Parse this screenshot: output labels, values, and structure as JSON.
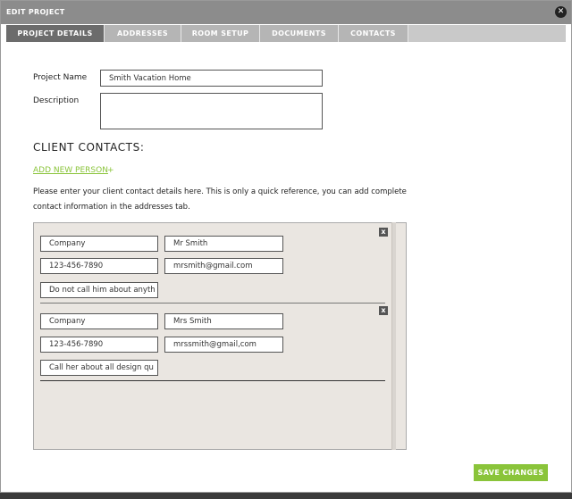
{
  "window": {
    "title": "EDIT PROJECT",
    "close_icon": "close-icon"
  },
  "tabs": [
    {
      "label": "PROJECT DETAILS",
      "active": true
    },
    {
      "label": "ADDRESSES",
      "active": false
    },
    {
      "label": "ROOM SETUP",
      "active": false
    },
    {
      "label": "DOCUMENTS",
      "active": false
    },
    {
      "label": "CONTACTS",
      "active": false
    }
  ],
  "form": {
    "project_name_label": "Project Name",
    "project_name_value": "Smith Vacation Home",
    "description_label": "Description",
    "description_value": ""
  },
  "client_contacts": {
    "heading": "CLIENT CONTACTS:",
    "add_link": "ADD NEW PERSON",
    "add_plus": "+",
    "help_text": "Please enter your client contact details here. This is only a quick reference, you can add complete contact information in the addresses tab.",
    "contacts": [
      {
        "company": "Company",
        "name": "Mr Smith",
        "phone": "123-456-7890",
        "email": "mrsmith@gmail.com",
        "notes": "Do not call him about anyth"
      },
      {
        "company": "Company",
        "name": "Mrs Smith",
        "phone": "123-456-7890",
        "email": "mrssmith@gmail,com",
        "notes": "Call her about all design qu"
      }
    ],
    "remove_label": "x"
  },
  "footer": {
    "save_label": "SAVE CHANGES"
  },
  "colors": {
    "accent": "#8ac43a",
    "tab_active": "#6c6c6c",
    "tab_inactive": "#b5b5b5",
    "panel_bg": "#eae6e1"
  }
}
